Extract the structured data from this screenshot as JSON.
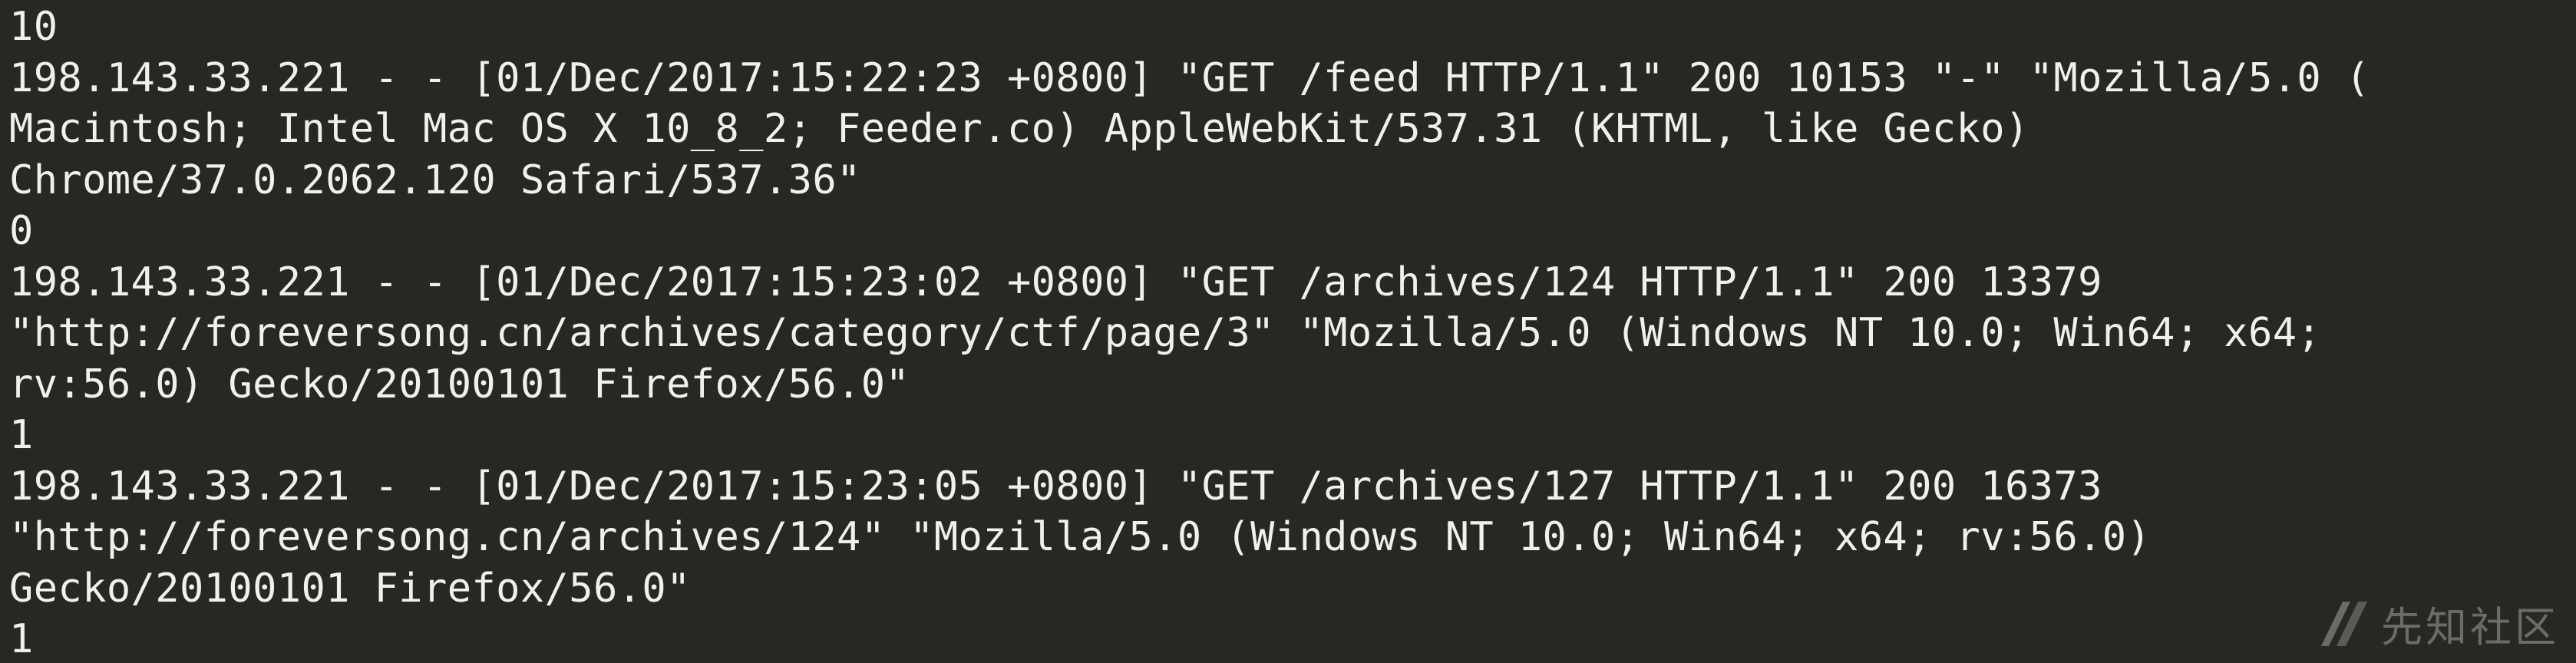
{
  "terminal": {
    "background_color": "#272822",
    "text_color": "#f1f1ec",
    "lines": [
      "10",
      "198.143.33.221 - - [01/Dec/2017:15:22:23 +0800] \"GET /feed HTTP/1.1\" 200 10153 \"-\" \"Mozilla/5.0 (",
      "Macintosh; Intel Mac OS X 10_8_2; Feeder.co) AppleWebKit/537.31 (KHTML, like Gecko)",
      "Chrome/37.0.2062.120 Safari/537.36\"",
      "0",
      "198.143.33.221 - - [01/Dec/2017:15:23:02 +0800] \"GET /archives/124 HTTP/1.1\" 200 13379",
      "\"http://foreversong.cn/archives/category/ctf/page/3\" \"Mozilla/5.0 (Windows NT 10.0; Win64; x64;",
      "rv:56.0) Gecko/20100101 Firefox/56.0\"",
      "1",
      "198.143.33.221 - - [01/Dec/2017:15:23:05 +0800] \"GET /archives/127 HTTP/1.1\" 200 16373",
      "\"http://foreversong.cn/archives/124\" \"Mozilla/5.0 (Windows NT 10.0; Win64; x64; rv:56.0)",
      "Gecko/20100101 Firefox/56.0\"",
      "1"
    ]
  },
  "watermark": {
    "text": "先知社区",
    "icon": "xianzhi-logo-icon",
    "color": "#d9d9d9"
  }
}
